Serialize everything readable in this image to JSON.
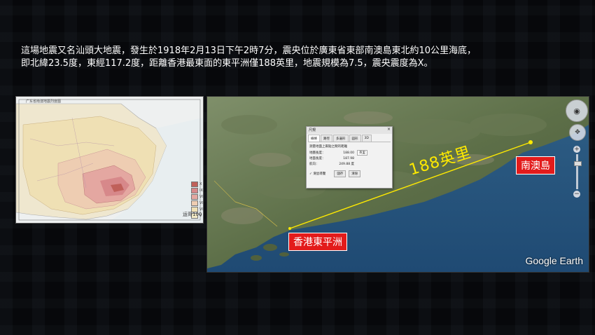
{
  "description": {
    "line1": "這場地震又名汕頭大地震，發生於1918年2月13日下午2時7分，震央位於廣東省東部南澳島東北約10公里海底，",
    "line2": "即北緯23.5度，東經117.2度，距離香港最東面的東平洲僅188英里，地震規模為7.5，震央震度為X。"
  },
  "intensity_map": {
    "title": "广东省南澳地震烈度图",
    "watermark": "运哥100",
    "legend": [
      "X",
      "IX",
      "VIII",
      "VII",
      "VI",
      "V"
    ],
    "colors": [
      "#c0605a",
      "#d7888a",
      "#e4a7a1",
      "#eecdb2",
      "#efe0b4",
      "#f3ebc7"
    ]
  },
  "earth_view": {
    "distance_label": "188英里",
    "place_nanao": "南澳島",
    "place_hk": "香港東平洲",
    "logo": "Google Earth",
    "line_color": "#ffea00",
    "label_color": "#e31b1b"
  },
  "ruler_dialog": {
    "title": "尺規",
    "close": "×",
    "tabs": [
      "線條",
      "路徑",
      "多邊形",
      "圓形",
      "3D"
    ],
    "description": "測量地面上兩點之間的距離",
    "rows": [
      {
        "label": "地圖長度：",
        "value": "188.00",
        "unit": "英里"
      },
      {
        "label": "地面長度：",
        "value": "187.98",
        "unit": ""
      },
      {
        "label": "航向：",
        "value": "249.88 度",
        "unit": ""
      }
    ],
    "mouse_nav": "滑鼠導覽",
    "save": "儲存",
    "clear": "清除"
  },
  "nav": {
    "zoom_plus": "+",
    "zoom_minus": "−"
  }
}
